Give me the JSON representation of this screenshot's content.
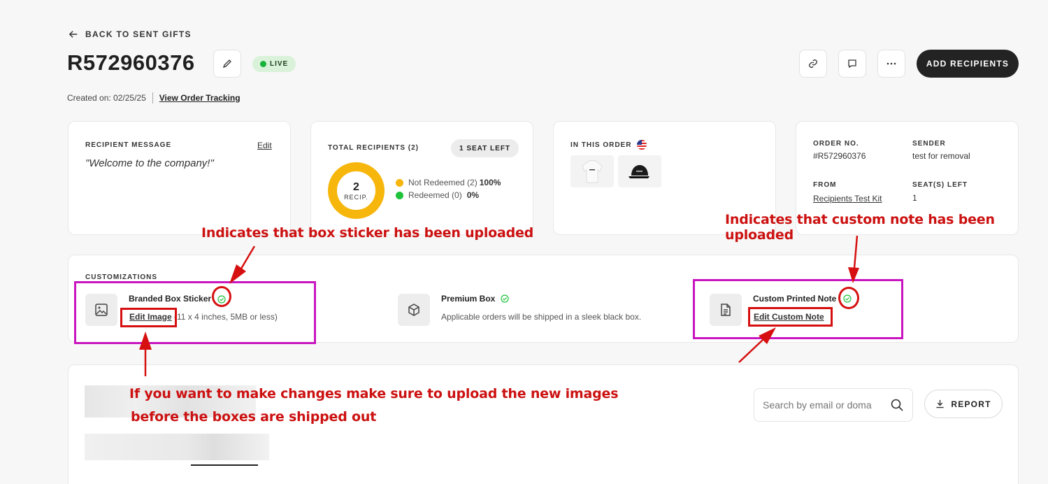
{
  "header": {
    "back_label": "BACK TO SENT GIFTS",
    "order_title": "R572960376",
    "status_badge": "LIVE",
    "created_label": "Created on: 02/25/25",
    "view_tracking": "View Order Tracking",
    "add_recipients": "ADD RECIPIENTS"
  },
  "recipient_message": {
    "label": "RECIPIENT MESSAGE",
    "edit": "Edit",
    "message": "\"Welcome to the company!\""
  },
  "total_recipients": {
    "label": "TOTAL RECIPIENTS (2)",
    "seat_badge": "1 SEAT LEFT",
    "count": "2",
    "count_unit": "RECIP.",
    "not_redeemed_label": "Not Redeemed (2)",
    "not_redeemed_pct": "100%",
    "redeemed_label": "Redeemed (0)",
    "redeemed_pct": "0%",
    "colors": {
      "not_redeemed": "#f6b60b",
      "redeemed": "#1fc23a"
    }
  },
  "in_this_order": {
    "label": "IN THIS ORDER",
    "flag_icon": "us-flag-icon",
    "items": [
      "hoodie",
      "cap"
    ]
  },
  "order_info": {
    "order_no_label": "ORDER NO.",
    "order_no": "#R572960376",
    "sender_label": "SENDER",
    "sender": "test for removal",
    "from_label": "FROM",
    "from": "Recipients Test Kit",
    "seats_label": "SEAT(S) LEFT",
    "seats": "1"
  },
  "customizations": {
    "label": "CUSTOMIZATIONS",
    "sticker_title": "Branded Box Sticker",
    "sticker_edit": "Edit Image",
    "sticker_desc": "(11 x 4 inches, 5MB or less)",
    "premium_title": "Premium Box",
    "premium_desc": "Applicable orders will be shipped in a sleek black box.",
    "note_title": "Custom Printed Note",
    "note_edit": "Edit Custom Note"
  },
  "recipients_panel": {
    "search_placeholder": "Search by email or doma",
    "report": "REPORT"
  },
  "annotations": {
    "sticker_note": "Indicates that box sticker has been uploaded",
    "custom_note": "Indicates that custom note has been uploaded",
    "upload_line1": "If you want to make changes make sure to upload the new images",
    "upload_line2": "before the boxes are shipped out"
  },
  "colors": {
    "accent_dark": "#232323",
    "annotation_red": "#cc1111",
    "annotation_magenta": "#c815c0",
    "check_green": "#1fc23a"
  }
}
